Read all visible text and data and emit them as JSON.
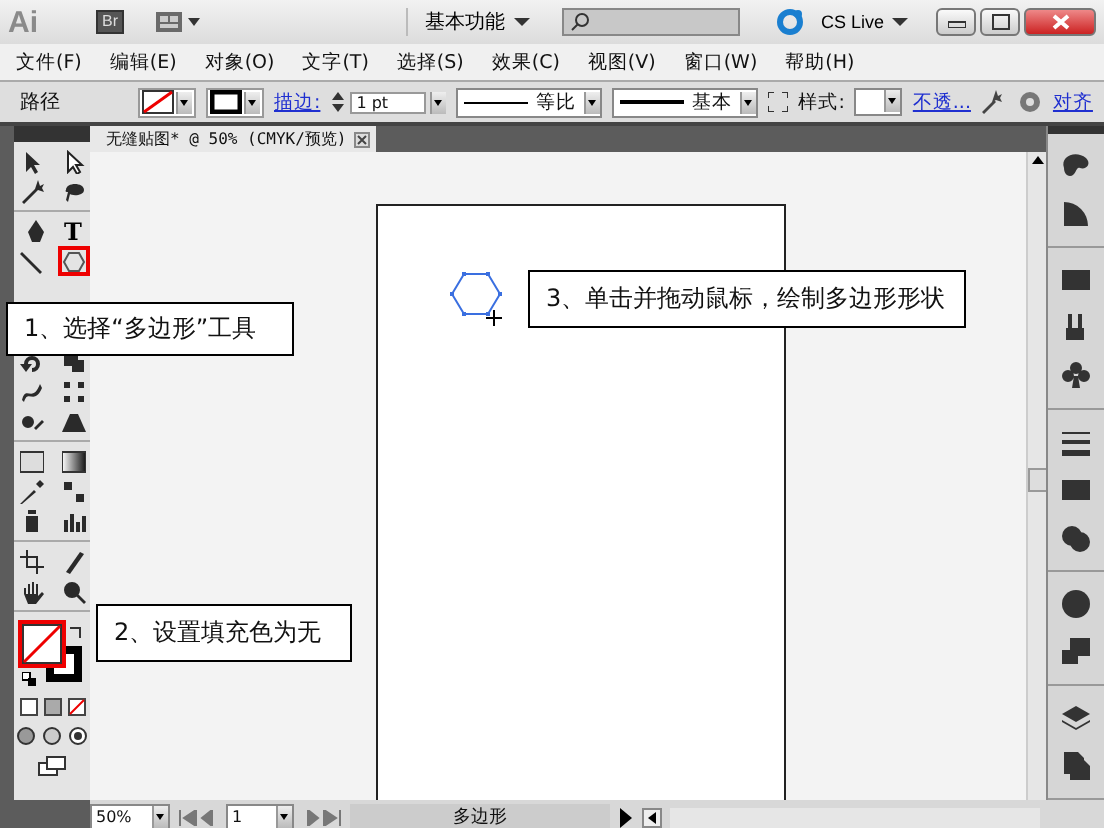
{
  "app": {
    "logo": "Ai",
    "bridge_button": "Br",
    "workspace": "基本功能",
    "cs_live": "CS Live"
  },
  "menu": [
    "文件(F)",
    "编辑(E)",
    "对象(O)",
    "文字(T)",
    "选择(S)",
    "效果(C)",
    "视图(V)",
    "窗口(W)",
    "帮助(H)"
  ],
  "control_bar": {
    "selection_label": "路径",
    "stroke_link": "描边:",
    "stroke_weight": "1 pt",
    "profile": "等比",
    "brush": "基本",
    "style_label": "样式:",
    "opacity_link": "不透...",
    "align_link": "对齐"
  },
  "document_tab": {
    "title": "无缝贴图* @ 50% (CMYK/预览)"
  },
  "toolbox": {
    "type_tool": "T",
    "polygon_tool_highlighted": true,
    "fill_swatch_highlighted": true
  },
  "callouts": [
    {
      "text": "1、选择“多边形”工具"
    },
    {
      "text": "2、设置填充色为无"
    },
    {
      "text": "3、单击并拖动鼠标，绘制多边形形状"
    }
  ],
  "status_bar": {
    "zoom": "50%",
    "page": "1",
    "status": "多边形"
  }
}
